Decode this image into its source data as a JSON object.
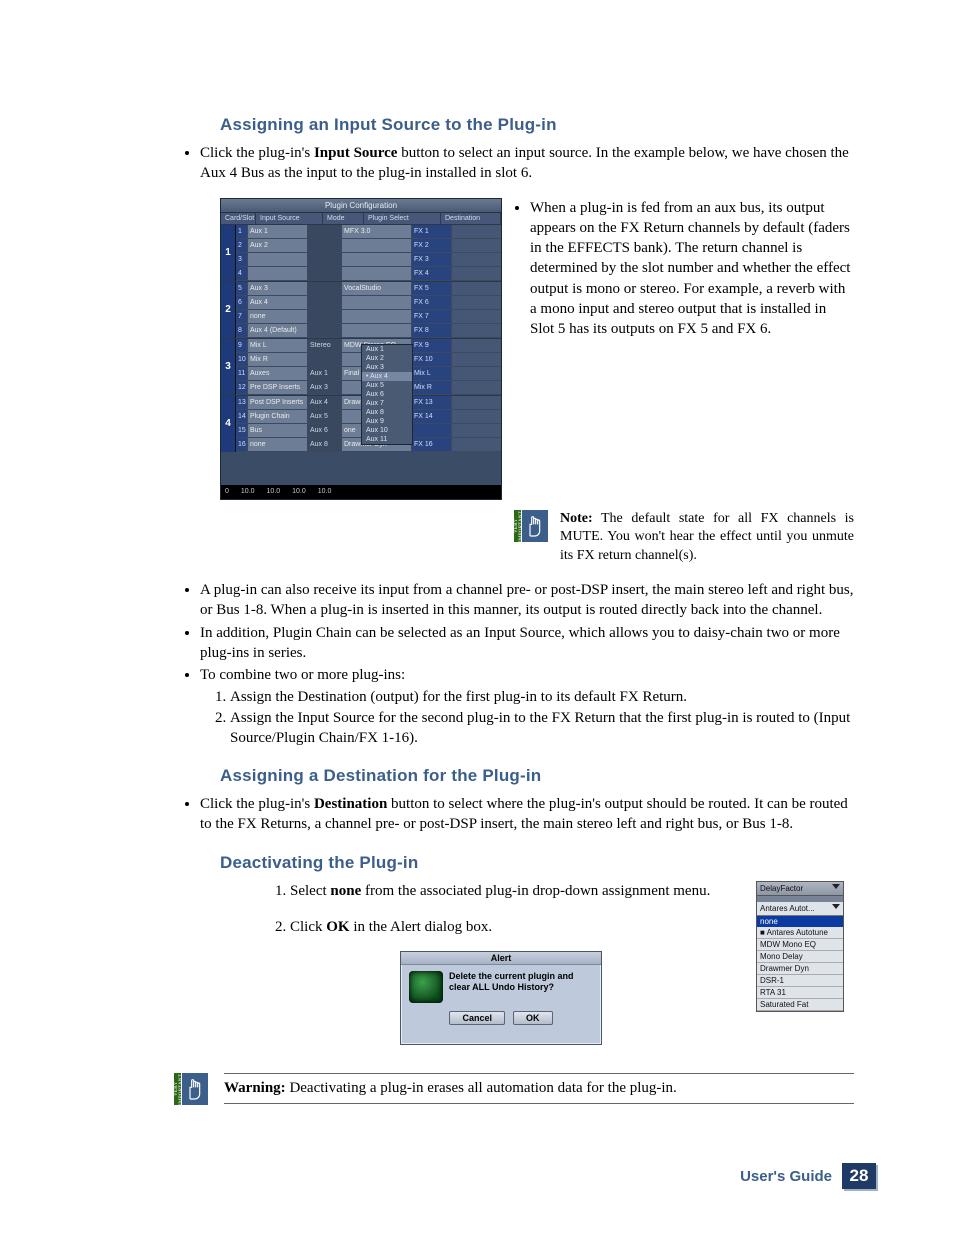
{
  "headings": {
    "assign_input": "Assigning an Input Source to the Plug-in",
    "assign_dest": "Assigning a Destination for the Plug-in",
    "deactivate": "Deactivating the Plug-in"
  },
  "para": {
    "p1a": "Click the plug-in's ",
    "p1b": "Input Source",
    "p1c": " button to select an input source. In the example below, we have chosen the Aux 4 Bus as the input to the plug-in installed in slot 6.",
    "right1": "When a plug-in is fed from an aux bus, its output appears on the FX Return channels by default (faders in the EFFECTS bank). The return channel is determined by the slot number and whether the effect output is mono or stereo. For example, a reverb with a mono input and stereo output that is installed in Slot 5 has its outputs on FX 5 and FX 6.",
    "note_label": "Note:",
    "note_body": " The default state for all FX channels is MUTE. You won't hear the effect until you unmute its FX return channel(s).",
    "b2": "A plug-in can also receive its input from a channel pre- or post-DSP insert, the main stereo left and right bus, or Bus 1-8. When a plug-in is inserted in this manner, its output is routed directly back into the channel.",
    "b3": "In addition, Plugin Chain can be selected as an Input Source, which allows you to daisy-chain two or more plug-ins in series.",
    "b4": "To combine two or more plug-ins:",
    "b4_1": "Assign the Destination (output) for the first plug-in to its default FX Return.",
    "b4_2": "Assign the Input Source for the second plug-in to the FX Return that the first plug-in is routed to (Input Source/Plugin Chain/FX 1-16).",
    "dest_a": "Click the plug-in's ",
    "dest_b": "Destination",
    "dest_c": " button to select where the plug-in's output should be routed. It can be routed to the FX Returns, a channel pre- or post-DSP insert, the main stereo left and right bus, or Bus 1-8.",
    "deact_1a": "Select ",
    "deact_1b": "none",
    "deact_1c": " from the associated plug-in drop-down assignment menu.",
    "deact_2a": "Click ",
    "deact_2b": "OK",
    "deact_2c": " in the Alert dialog box.",
    "warn_label": "Warning:",
    "warn_body": " Deactivating a plug-in erases all automation data for the plug-in."
  },
  "plugin_fig": {
    "title": "Plugin Configuration",
    "cols": {
      "card": "Card/Slot",
      "input": "Input Source",
      "mode": "Mode",
      "plugin": "Plugin Select",
      "dest": "Destination"
    },
    "slots": [
      {
        "num": "1",
        "rows": [
          {
            "idx": "1",
            "in": "Aux 1",
            "mode": "",
            "plugin": "MFX 3.0",
            "dest": "FX 1"
          },
          {
            "idx": "2",
            "in": "Aux 2",
            "mode": "",
            "plugin": "",
            "dest": "FX 2"
          },
          {
            "idx": "3",
            "in": "",
            "mode": "",
            "plugin": "",
            "dest": "FX 3"
          },
          {
            "idx": "4",
            "in": "",
            "mode": "",
            "plugin": "",
            "dest": "FX 4"
          }
        ]
      },
      {
        "num": "2",
        "rows": [
          {
            "idx": "5",
            "in": "Aux 3",
            "mode": "",
            "plugin": "VocalStudio",
            "dest": "FX 5"
          },
          {
            "idx": "6",
            "in": "Aux 4",
            "mode": "",
            "plugin": "",
            "dest": "FX 6"
          },
          {
            "idx": "7",
            "in": "none",
            "mode": "",
            "plugin": "",
            "dest": "FX 7"
          },
          {
            "idx": "8",
            "in": "Aux 4 (Default)",
            "mode": "",
            "plugin": "",
            "dest": "FX 8"
          }
        ]
      },
      {
        "num": "3",
        "rows": [
          {
            "idx": "9",
            "in": "Mix L",
            "mode": "Stereo",
            "plugin": "MDW Stereo EQ",
            "dest": "FX 9"
          },
          {
            "idx": "10",
            "in": "Mix R",
            "mode": "",
            "plugin": "",
            "dest": "FX 10"
          },
          {
            "idx": "11",
            "in": "Auxes",
            "mode": "Aux 1",
            "plugin": "Final Mix",
            "dest": "Mix L"
          },
          {
            "idx": "12",
            "in": "Pre DSP Inserts",
            "mode": "Aux 3",
            "plugin": "",
            "dest": "Mix R"
          }
        ]
      },
      {
        "num": "4",
        "rows": [
          {
            "idx": "13",
            "in": "Post DSP Inserts",
            "mode": "Aux 4",
            "plugin": "Drawmer Dyn",
            "dest": "FX 13"
          },
          {
            "idx": "14",
            "in": "Plugin Chain",
            "mode": "Aux 5",
            "plugin": "",
            "dest": "FX 14"
          },
          {
            "idx": "15",
            "in": "Bus",
            "mode": "Aux 6",
            "plugin": "one",
            "dest": ""
          },
          {
            "idx": "16",
            "in": "none",
            "mode": "Aux 8",
            "plugin": "Drawmer Dyn",
            "dest": "FX 16"
          }
        ]
      }
    ],
    "popup": [
      "Aux 1",
      "Aux 2",
      "Aux 3",
      "Aux 4",
      "Aux 5",
      "Aux 6",
      "Aux 7",
      "Aux 8",
      "Aux 9",
      "Aux 10",
      "Aux 11"
    ],
    "ruler": [
      "0",
      "10.0",
      "10.0",
      "10.0",
      "10.0"
    ]
  },
  "dropdown_fig": {
    "header": "DelayFactor",
    "sub": "Antares Autot...",
    "none": "none",
    "items": [
      "Antares Autotune",
      "MDW Mono EQ",
      "Mono Delay",
      "Drawmer Dyn",
      "DSR-1",
      "RTA 31",
      "Saturated Fat"
    ]
  },
  "alert_fig": {
    "title": "Alert",
    "msg": "Delete the current plugin and clear ALL Undo History?",
    "cancel": "Cancel",
    "ok": "OK"
  },
  "footer": {
    "guide": "User's Guide",
    "pagenum": "28"
  },
  "icon_tab": "VERY IMPORTANT"
}
